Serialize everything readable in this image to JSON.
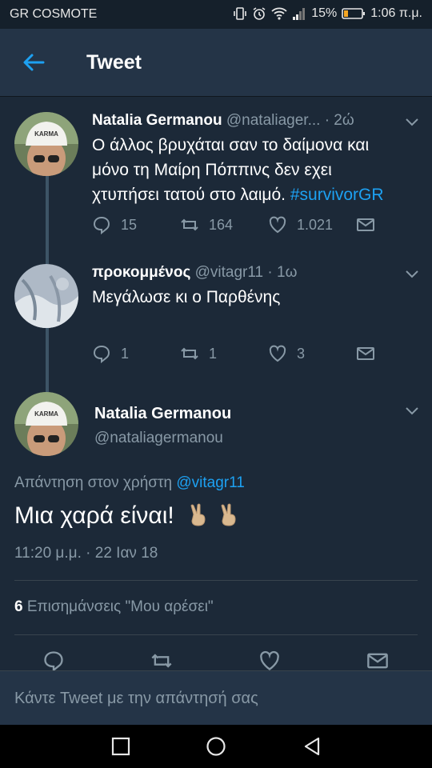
{
  "status_bar": {
    "carrier": "GR COSMOTE",
    "battery": "15%",
    "time": "1:06 π.μ."
  },
  "header": {
    "title": "Tweet"
  },
  "tweets": [
    {
      "name": "Natalia Germanou",
      "handle": "@nataliager...",
      "time": "· 2ώ",
      "text_line1": "Ο άλλος βρυχάται σαν το δαίμονα και",
      "text_line2": "μόνο τη Μαίρη Πόππινς δεν εχει",
      "text_line3": "χτυπήσει τατού στο λαιμό.",
      "hashtag": "#survivorGR",
      "replies": "15",
      "retweets": "164",
      "likes": "1.021"
    },
    {
      "name": "προκομμένος",
      "handle": "@vitagr11",
      "time": "· 1ω",
      "text": "Μεγάλωσε κι ο Παρθένης",
      "replies": "1",
      "retweets": "1",
      "likes": "3"
    }
  ],
  "main_tweet": {
    "name": "Natalia Germanou",
    "handle": "@nataliagermanou",
    "reply_to_label": "Απάντηση στον χρήστη",
    "reply_to_handle": "@vitagr11",
    "text": "Μια χαρά είναι!",
    "timestamp": "11:20 μ.μ. · 22 Ιαν 18",
    "likes_count": "6",
    "likes_label": "Επισημάνσεις \"Μου αρέσει\""
  },
  "compose": {
    "placeholder": "Κάντε Tweet με την απάντησή σας"
  },
  "colors": {
    "accent": "#1da1f2",
    "background": "#1c2938",
    "header": "#243447",
    "muted": "#8899a6"
  },
  "icons": [
    "back-arrow-icon",
    "reply-icon",
    "retweet-icon",
    "like-icon",
    "message-icon",
    "chevron-down-icon",
    "clap-emoji-icon",
    "nav-back-icon",
    "nav-home-icon",
    "nav-recents-icon"
  ]
}
